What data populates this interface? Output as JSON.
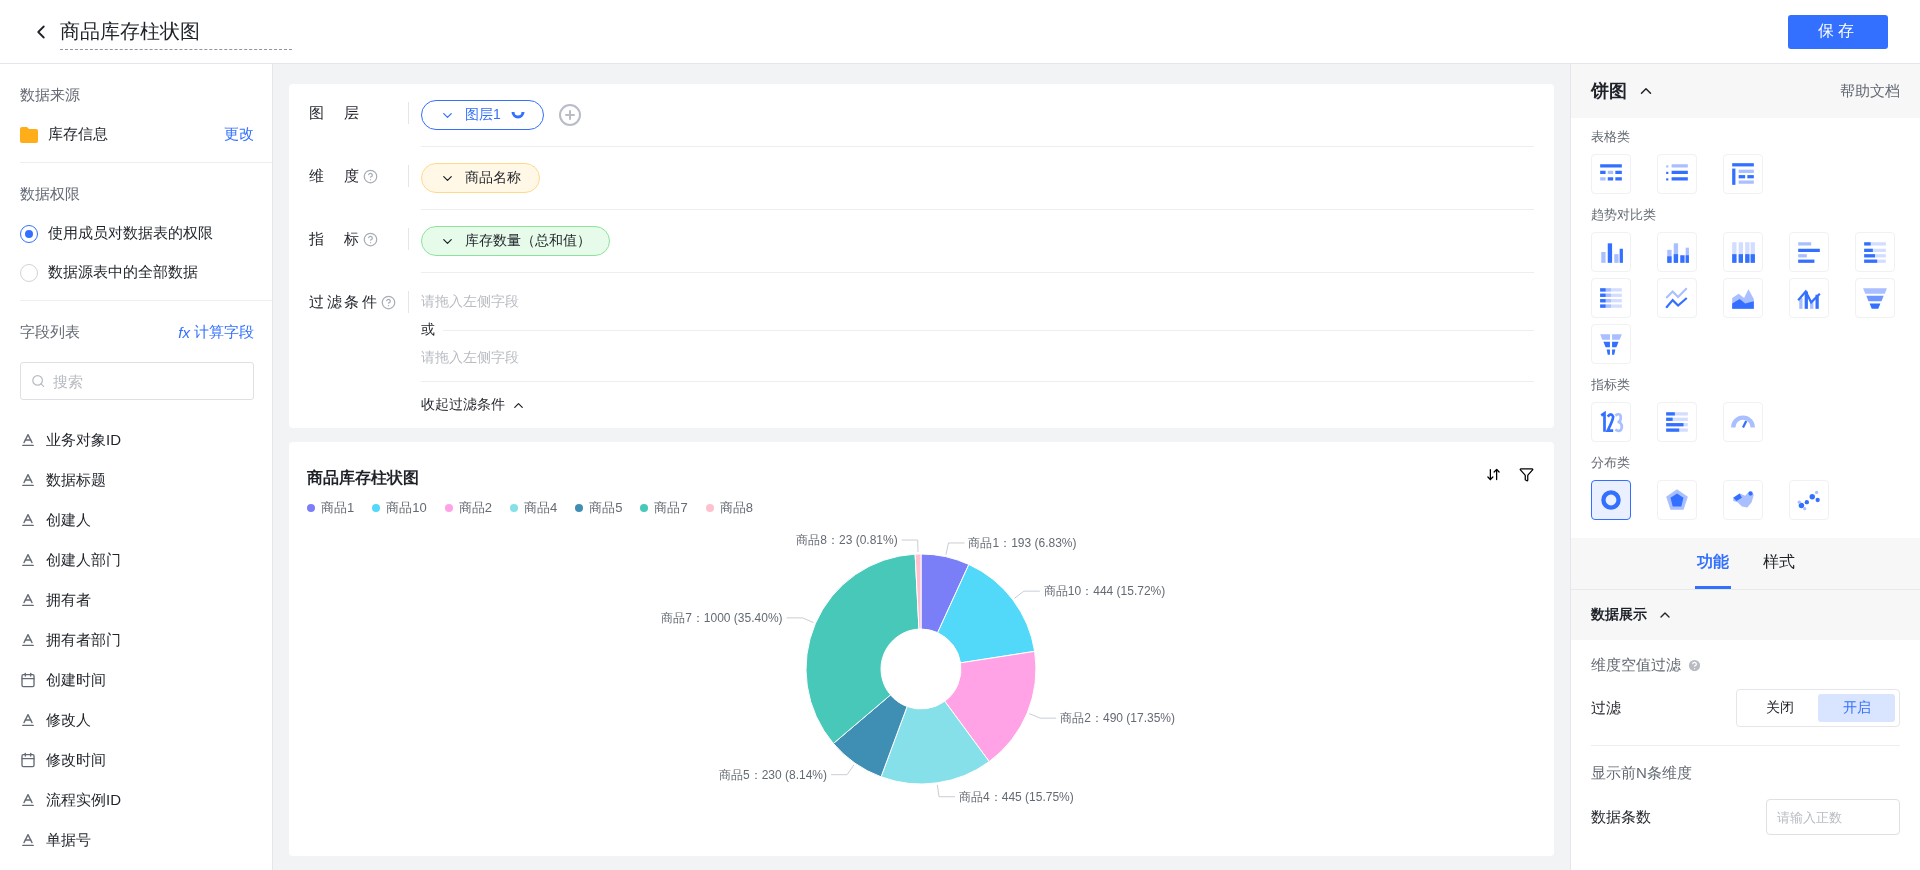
{
  "header": {
    "title": "商品库存柱状图",
    "save_button": "保存"
  },
  "sidebar": {
    "source_heading": "数据来源",
    "source_name": "库存信息",
    "change_link": "更改",
    "permission_heading": "数据权限",
    "permissions": [
      {
        "label": "使用成员对数据表的权限",
        "selected": true
      },
      {
        "label": "数据源表中的全部数据",
        "selected": false
      }
    ],
    "fields_heading": "字段列表",
    "calc_icon": "fx",
    "calc_link": "计算字段",
    "search_placeholder": "搜索",
    "fields": [
      {
        "kind": "text",
        "label": "业务对象ID"
      },
      {
        "kind": "text",
        "label": "数据标题"
      },
      {
        "kind": "text",
        "label": "创建人"
      },
      {
        "kind": "text",
        "label": "创建人部门"
      },
      {
        "kind": "text",
        "label": "拥有者"
      },
      {
        "kind": "text",
        "label": "拥有者部门"
      },
      {
        "kind": "date",
        "label": "创建时间"
      },
      {
        "kind": "text",
        "label": "修改人"
      },
      {
        "kind": "date",
        "label": "修改时间"
      },
      {
        "kind": "text",
        "label": "流程实例ID"
      },
      {
        "kind": "text",
        "label": "单据号"
      }
    ]
  },
  "config": {
    "rows": [
      {
        "kind": "layer",
        "label": "图层",
        "help": false,
        "value": "图层1"
      },
      {
        "kind": "dimension",
        "label": "维度",
        "help": true,
        "value": "商品名称"
      },
      {
        "kind": "metric",
        "label": "指标",
        "help": true,
        "value": "库存数量（总和值）"
      },
      {
        "kind": "filter",
        "label": "过滤条件",
        "help": true,
        "placeholders": [
          "请拖入左侧字段",
          "请拖入左侧字段"
        ],
        "or_text": "或",
        "collapse": "收起过滤条件"
      }
    ]
  },
  "chart": {
    "title": "商品库存柱状图",
    "legend": [
      {
        "label": "商品1",
        "color": "#7b7ff7"
      },
      {
        "label": "商品10",
        "color": "#52d8f8"
      },
      {
        "label": "商品2",
        "color": "#ffa3e6"
      },
      {
        "label": "商品4",
        "color": "#86e0ea"
      },
      {
        "label": "商品5",
        "color": "#3f8fb4"
      },
      {
        "label": "商品7",
        "color": "#47c8b9"
      },
      {
        "label": "商品8",
        "color": "#ffc0cf"
      }
    ],
    "chart_data": {
      "type": "donut",
      "categories": [
        "商品1",
        "商品10",
        "商品2",
        "商品4",
        "商品5",
        "商品7",
        "商品8"
      ],
      "values": [
        193,
        444,
        490,
        445,
        230,
        1000,
        23
      ],
      "value_labels": [
        "：193 (6.83%)",
        "：444 (15.72%)",
        "：490 (17.35%)",
        "：445 (15.75%)",
        "：230 (8.14%)",
        "：1000 (35.40%)",
        "：23 (0.81%)"
      ]
    }
  },
  "right_panel": {
    "title": "饼图",
    "help_link": "帮助文档",
    "groups": [
      {
        "title": "表格类",
        "items": [
          {
            "kind": "table",
            "selected": false
          },
          {
            "kind": "list",
            "selected": false
          },
          {
            "kind": "crosstab",
            "selected": false
          }
        ]
      },
      {
        "title": "趋势对比类",
        "items": [
          {
            "kind": "bar",
            "selected": false
          },
          {
            "kind": "stacked-bar",
            "selected": false
          },
          {
            "kind": "percent-bar",
            "selected": false
          },
          {
            "kind": "hbar",
            "selected": false
          },
          {
            "kind": "stacked-hbar",
            "selected": false
          },
          {
            "kind": "percent-hbar",
            "selected": false
          },
          {
            "kind": "line",
            "selected": false
          },
          {
            "kind": "area",
            "selected": false
          },
          {
            "kind": "combo",
            "selected": false
          },
          {
            "kind": "funnel",
            "selected": false
          },
          {
            "kind": "split-funnel",
            "selected": false
          }
        ]
      },
      {
        "title": "指标类",
        "items": [
          {
            "kind": "number",
            "selected": false
          },
          {
            "kind": "progress",
            "selected": false
          },
          {
            "kind": "gauge",
            "selected": false
          }
        ]
      },
      {
        "title": "分布类",
        "items": [
          {
            "kind": "donut",
            "selected": true
          },
          {
            "kind": "radar",
            "selected": false
          },
          {
            "kind": "map",
            "selected": false
          },
          {
            "kind": "scatter",
            "selected": false
          }
        ]
      }
    ],
    "tabs": [
      {
        "label": "功能",
        "selected": true
      },
      {
        "label": "样式",
        "selected": false
      }
    ],
    "section": "数据展示",
    "null_filter_heading": "维度空值过滤",
    "filter_label": "过滤",
    "filter_options": [
      {
        "label": "关闭",
        "selected": false
      },
      {
        "label": "开启",
        "selected": true
      }
    ],
    "topn_heading": "显示前N条维度",
    "count_label": "数据条数",
    "count_placeholder": "请输入正数"
  }
}
